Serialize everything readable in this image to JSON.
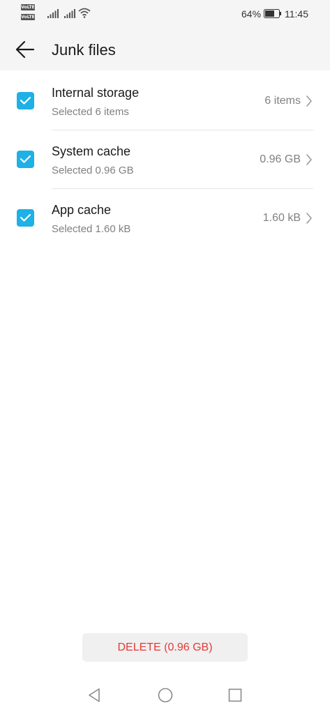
{
  "status_bar": {
    "volte_badge": "VoLTE",
    "battery_percent": "64%",
    "time": "11:45"
  },
  "header": {
    "title": "Junk files",
    "back_icon": "arrow-left-icon"
  },
  "items": [
    {
      "title": "Internal storage",
      "subtitle": "Selected 6 items",
      "value": "6 items",
      "checked": true
    },
    {
      "title": "System cache",
      "subtitle": "Selected 0.96 GB",
      "value": "0.96 GB",
      "checked": true
    },
    {
      "title": "App cache",
      "subtitle": "Selected 1.60 kB",
      "value": "1.60 kB",
      "checked": true
    }
  ],
  "delete_button": {
    "label": "DELETE (0.96 GB)"
  },
  "colors": {
    "accent": "#1db1e6",
    "delete_text": "#e53935",
    "header_bg": "#f5f5f5"
  },
  "nav_bar": {
    "back_icon": "triangle-back-icon",
    "home_icon": "circle-home-icon",
    "recents_icon": "square-recents-icon"
  }
}
